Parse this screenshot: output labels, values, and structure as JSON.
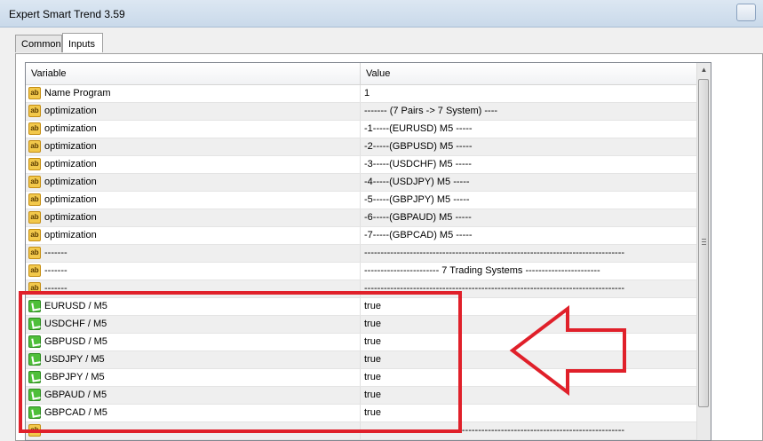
{
  "window": {
    "title": "Expert Smart Trend 3.59"
  },
  "tabs": [
    {
      "label": "Common"
    },
    {
      "label": "Inputs"
    }
  ],
  "table": {
    "headers": {
      "variable": "Variable",
      "value": "Value"
    },
    "rows": [
      {
        "variable": "Name Program",
        "value": "1",
        "icon": "text-param-icon"
      },
      {
        "variable": "optimization",
        "value": "------- (7 Pairs -> 7 System) ----",
        "icon": "text-param-icon"
      },
      {
        "variable": "optimization",
        "value": "-1-----(EURUSD) M5 -----",
        "icon": "text-param-icon"
      },
      {
        "variable": "optimization",
        "value": "-2-----(GBPUSD) M5 -----",
        "icon": "text-param-icon"
      },
      {
        "variable": "optimization",
        "value": "-3-----(USDCHF) M5 -----",
        "icon": "text-param-icon"
      },
      {
        "variable": "optimization",
        "value": "-4-----(USDJPY) M5 -----",
        "icon": "text-param-icon"
      },
      {
        "variable": "optimization",
        "value": "-5-----(GBPJPY) M5 -----",
        "icon": "text-param-icon"
      },
      {
        "variable": "optimization",
        "value": "-6-----(GBPAUD) M5 -----",
        "icon": "text-param-icon"
      },
      {
        "variable": "optimization",
        "value": "-7-----(GBPCAD) M5 -----",
        "icon": "text-param-icon"
      },
      {
        "variable": "-------",
        "value": "--------------------------------------------------------------------------------",
        "icon": "text-param-icon"
      },
      {
        "variable": "-------",
        "value": "----------------------- 7 Trading Systems -----------------------",
        "icon": "text-param-icon"
      },
      {
        "variable": "-------",
        "value": "--------------------------------------------------------------------------------",
        "icon": "text-param-icon"
      },
      {
        "variable": "EURUSD / M5",
        "value": "true",
        "icon": "bool-param-icon"
      },
      {
        "variable": "USDCHF / M5",
        "value": "true",
        "icon": "bool-param-icon"
      },
      {
        "variable": "GBPUSD / M5",
        "value": "true",
        "icon": "bool-param-icon"
      },
      {
        "variable": "USDJPY / M5",
        "value": "true",
        "icon": "bool-param-icon"
      },
      {
        "variable": "GBPJPY / M5",
        "value": "true",
        "icon": "bool-param-icon"
      },
      {
        "variable": "GBPAUD / M5",
        "value": "true",
        "icon": "bool-param-icon"
      },
      {
        "variable": "GBPCAD / M5",
        "value": "true",
        "icon": "bool-param-icon"
      },
      {
        "variable": "",
        "value": "--------------------------------------------------------------------------------",
        "icon": "text-param-icon"
      }
    ]
  },
  "annotation": {
    "color": "#e0202a"
  }
}
